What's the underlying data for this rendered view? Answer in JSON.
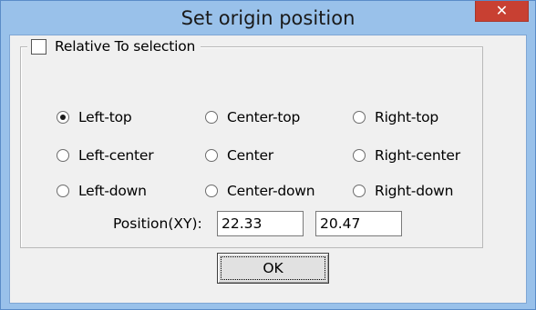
{
  "window": {
    "title": "Set origin position",
    "close_glyph": "✕"
  },
  "group": {
    "checkbox_label": "Relative To selection",
    "checked": false
  },
  "radios": [
    {
      "label": "Left-top",
      "selected": true
    },
    {
      "label": "Center-top",
      "selected": false
    },
    {
      "label": "Right-top",
      "selected": false
    },
    {
      "label": "Left-center",
      "selected": false
    },
    {
      "label": "Center",
      "selected": false
    },
    {
      "label": "Right-center",
      "selected": false
    },
    {
      "label": "Left-down",
      "selected": false
    },
    {
      "label": "Center-down",
      "selected": false
    },
    {
      "label": "Right-down",
      "selected": false
    }
  ],
  "position": {
    "label": "Position(XY):",
    "x": "22.33",
    "y": "20.47"
  },
  "buttons": {
    "ok_label": "OK"
  },
  "colors": {
    "titlebar": "#99c1ea",
    "close_button": "#c84032",
    "client": "#f0f0f0"
  }
}
